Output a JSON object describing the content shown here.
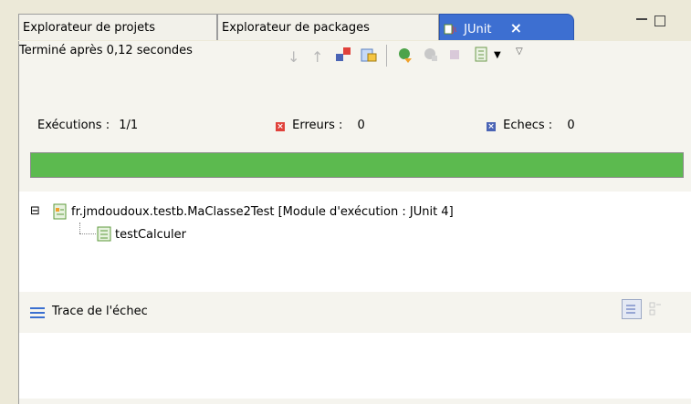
{
  "tabs": [
    {
      "label": "Explorateur de projets"
    },
    {
      "label": "Explorateur de packages"
    },
    {
      "label": "JUnit",
      "close": "×"
    }
  ],
  "toolbar": {
    "status": "Terminé après 0,12 secondes"
  },
  "counters": {
    "runs_label": "Exécutions :",
    "runs_value": "1/1",
    "errors_label": "Erreurs :",
    "errors_value": "0",
    "failures_label": "Echecs :",
    "failures_value": "0"
  },
  "progress": {
    "fraction": 1.0,
    "color": "#5cba4f"
  },
  "tree": {
    "root": "fr.jmdoudoux.testb.MaClasse2Test [Module d'exécution : JUnit 4]",
    "child": "testCalculer",
    "expander": "⊟"
  },
  "trace": {
    "title": "Trace de l'échec"
  },
  "colors": {
    "error": "#e0413a",
    "failure": "#4a64b5",
    "active_tab": "#3d6fd1"
  }
}
